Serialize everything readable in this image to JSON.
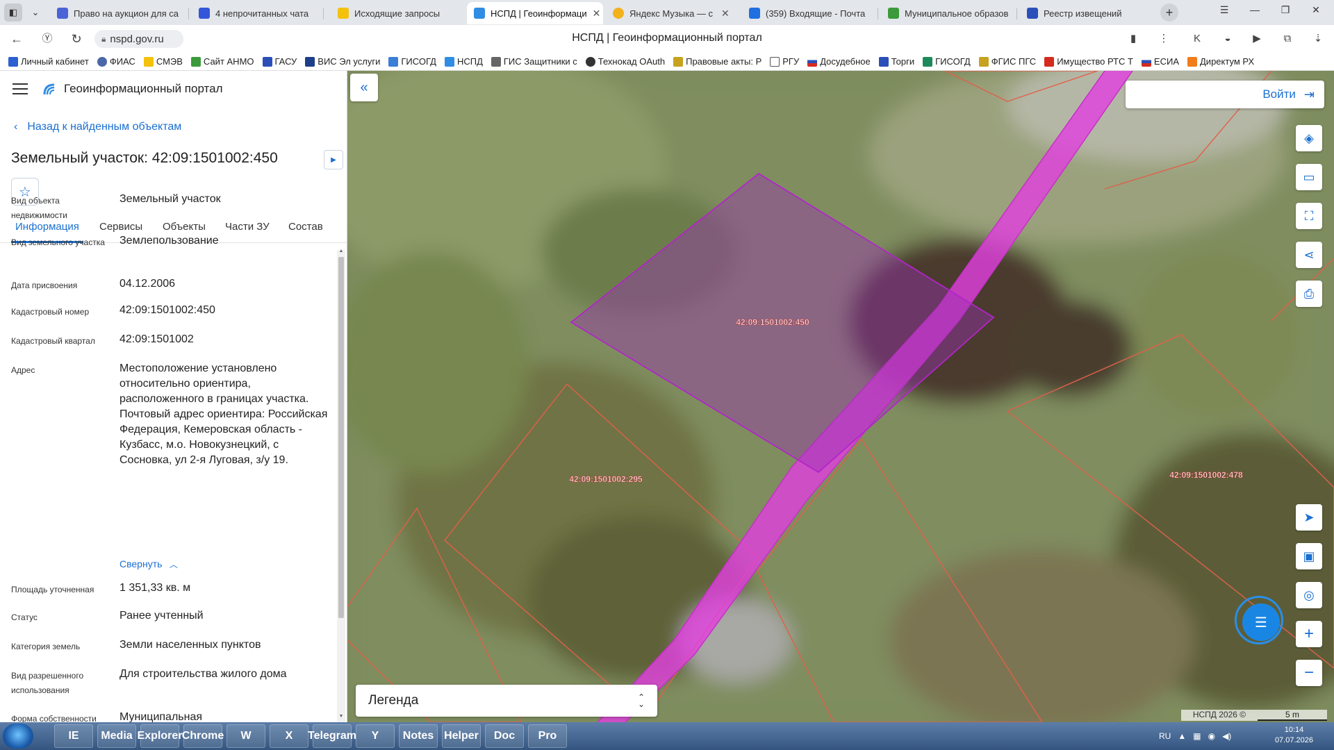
{
  "browser": {
    "tabs": [
      {
        "label": "Право на аукцион для са",
        "active": false
      },
      {
        "label": "4 непрочитанных чата",
        "active": false
      },
      {
        "label": "Исходящие запросы",
        "active": false
      },
      {
        "label": "НСПД | Геоинформаци",
        "active": true
      },
      {
        "label": "Яндекс Музыка — с",
        "active": false
      },
      {
        "label": "(359) Входящие - Почта",
        "active": false
      },
      {
        "label": "Муниципальное образов",
        "active": false
      },
      {
        "label": "Реестр извещений",
        "active": false
      }
    ],
    "url": "nspd.gov.ru",
    "page_title": "НСПД | Геоинформационный портал",
    "bookmarks": [
      "Личный кабинет",
      "ФИАС",
      "СМЭВ",
      "Сайт АНМО",
      "ГАСУ",
      "ВИС Эл услуги",
      "ГИСОГД",
      "НСПД",
      "ГИС Защитники с",
      "Технокад OAuth",
      "Правовые акты: Р",
      "РГУ",
      "Досудебное",
      "Торги",
      "ГИСОГД",
      "ФГИС ПГС",
      "Имущество РТС Т",
      "ЕСИА",
      "Директум РХ"
    ]
  },
  "panel": {
    "portal_name": "Геоинформационный портал",
    "back_link": "Назад к найденным объектам",
    "object_title": "Земельный участок: 42:09:1501002:450",
    "tabs": [
      "Информация",
      "Сервисы",
      "Объекты",
      "Части ЗУ",
      "Состав"
    ],
    "properties": [
      {
        "label": "Вид объекта недвижимости",
        "value": "Земельный участок"
      },
      {
        "label": "Вид земельного участка",
        "value": "Землепользование"
      },
      {
        "label": "Дата присвоения",
        "value": "04.12.2006"
      },
      {
        "label": "Кадастровый номер",
        "value": "42:09:1501002:450"
      },
      {
        "label": "Кадастровый квартал",
        "value": "42:09:1501002"
      },
      {
        "label": "Адрес",
        "value": "Местоположение установлено относительно ориентира, расположенного в границах участка. Почтовый адрес ориентира: Российская Федерация, Кемеровская область - Кузбасс, м.о. Новокузнецкий, с Сосновка, ул 2-я Луговая, з/у 19."
      },
      {
        "label": "Площадь уточненная",
        "value": "1 351,33 кв. м"
      },
      {
        "label": "Статус",
        "value": "Ранее учтенный"
      },
      {
        "label": "Категория земель",
        "value": "Земли населенных пунктов"
      },
      {
        "label": "Вид разрешенного использования",
        "value": "Для строительства жилого дома"
      },
      {
        "label": "Форма собственности",
        "value": "Муниципальная"
      }
    ],
    "collapse_label": "Свернуть"
  },
  "map": {
    "login_label": "Войти",
    "legend_label": "Легенда",
    "parcel_labels": [
      "42:09:1501002:450",
      "42:09:1501002:295",
      "42:09:1501002:478"
    ],
    "attribution": "НСПД 2026 ©",
    "scale": "5 m",
    "colors": {
      "parcel_fill": "#9c2fb4",
      "road_band": "#e23ee0",
      "boundary": "#e0604a",
      "accent": "#1a6fd1"
    }
  },
  "taskbar": {
    "apps": [
      "IE",
      "Media",
      "Explorer",
      "Chrome",
      "W",
      "X",
      "Telegram",
      "Y",
      "Notes",
      "Helper",
      "Doc",
      "Pro"
    ],
    "lang": "RU",
    "time": "10:14",
    "date": "07.07.2026"
  }
}
